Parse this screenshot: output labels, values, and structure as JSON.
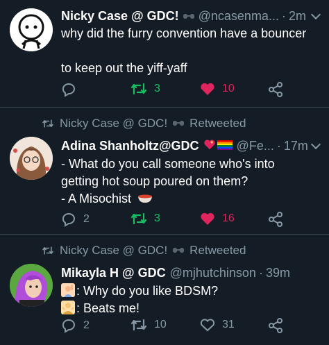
{
  "tweets": [
    {
      "name": "Nicky Case @ GDC!",
      "handle": "@ncasenma...",
      "time": "2m",
      "lines": [
        "why did the furry convention have a bouncer",
        "",
        "to keep out the yiff-yaff"
      ],
      "retweets": "3",
      "likes": "10",
      "liked": true,
      "retweeted": true
    },
    {
      "retweeted_by": "Nicky Case @ GDC!",
      "retweet_label": "Retweeted",
      "name": "Adina Shanholtz@GDC",
      "handle": "@Fe...",
      "time": "17m",
      "lines": [
        "- What do you call someone who's into",
        "getting hot soup poured on them?",
        "- A Misochist"
      ],
      "replies": "2",
      "retweets": "3",
      "likes": "16",
      "liked": true,
      "retweeted": true
    },
    {
      "retweeted_by": "Nicky Case @ GDC!",
      "retweet_label": "Retweeted",
      "name": "Mikayla H @ GDC",
      "handle": "@mjhutchinson",
      "time": "39m",
      "lines": [
        ": Why do you like BDSM?",
        ": Beats me!"
      ],
      "replies": "2",
      "retweets": "10",
      "likes": "31",
      "liked": false,
      "retweeted": false
    }
  ],
  "colors": {
    "background": "#141d26",
    "divider": "#38444d",
    "secondary_text": "#8899a6",
    "retweet_green": "#17bf63",
    "like_pink": "#e0245e"
  },
  "icons": [
    "reply-icon",
    "retweet-icon",
    "heart-icon",
    "share-icon",
    "chevron-down-icon",
    "mask-icon",
    "soup-icon",
    "raised-hand-icon",
    "shrug-icon",
    "sparkle-heart-icon",
    "rainbow-flag-icon"
  ]
}
